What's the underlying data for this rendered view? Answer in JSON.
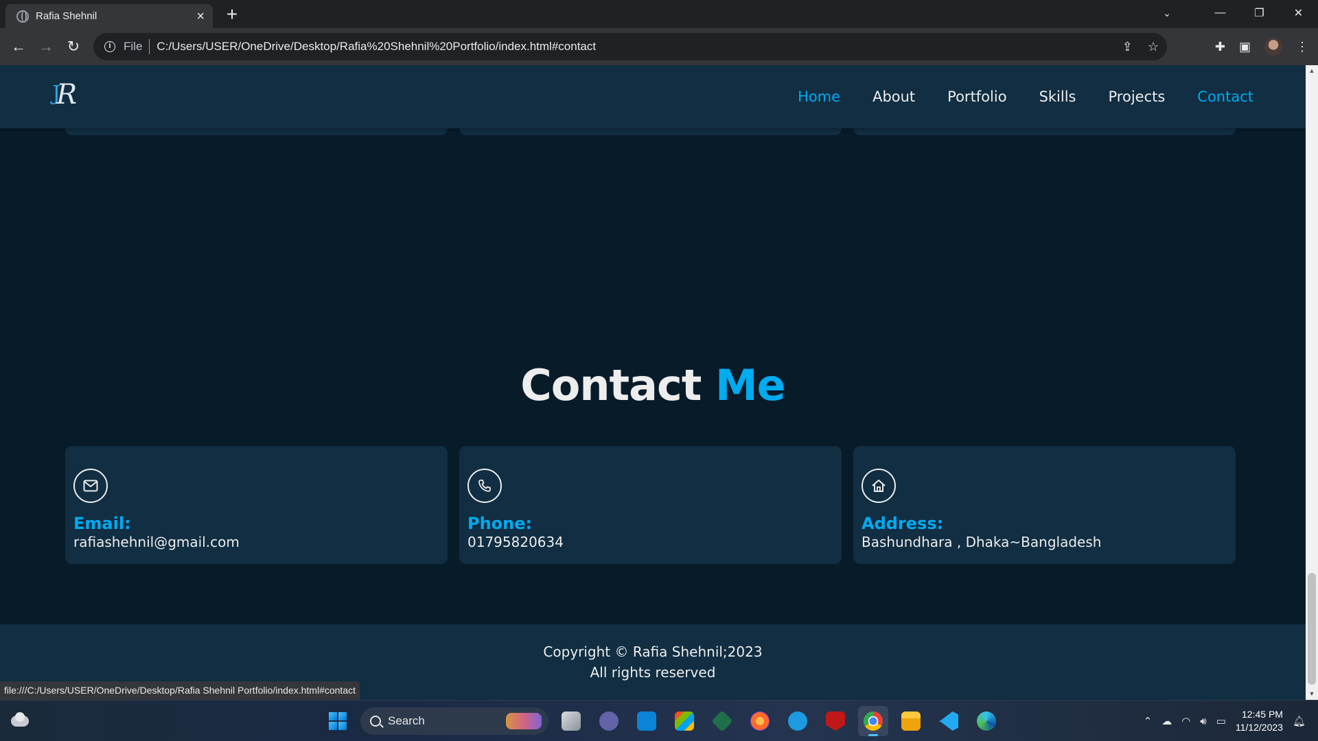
{
  "browser": {
    "tab_title": "Rafia Shehnil",
    "omnibox_scheme_label": "File",
    "url": "C:/Users/USER/OneDrive/Desktop/Rafia%20Shehnil%20Portfolio/index.html#contact",
    "status_url": "file:///C:/Users/USER/OneDrive/Desktop/Rafia Shehnil Portfolio/index.html#contact"
  },
  "site": {
    "logo_letter": "R",
    "nav": [
      {
        "label": "Home",
        "active": true
      },
      {
        "label": "About",
        "active": false
      },
      {
        "label": "Portfolio",
        "active": false
      },
      {
        "label": "Skills",
        "active": false
      },
      {
        "label": "Projects",
        "active": false
      },
      {
        "label": "Contact",
        "active": true
      }
    ],
    "contact_title_part1": "Contact",
    "contact_title_part2": "Me",
    "cards": [
      {
        "icon": "mail-icon",
        "label": "Email:",
        "value": "rafiashehnil@gmail.com"
      },
      {
        "icon": "phone-icon",
        "label": "Phone:",
        "value": "01795820634"
      },
      {
        "icon": "home-icon",
        "label": "Address:",
        "value": "Bashundhara , Dhaka~Bangladesh"
      }
    ],
    "footer_line1": "Copyright © Rafia Shehnil;2023",
    "footer_line2": "All rights reserved"
  },
  "taskbar": {
    "search_label": "Search",
    "time": "12:45 PM",
    "date": "11/12/2023"
  },
  "colors": {
    "accent": "#00abf0",
    "page_bg": "#081b29",
    "card_bg": "#112e42"
  }
}
